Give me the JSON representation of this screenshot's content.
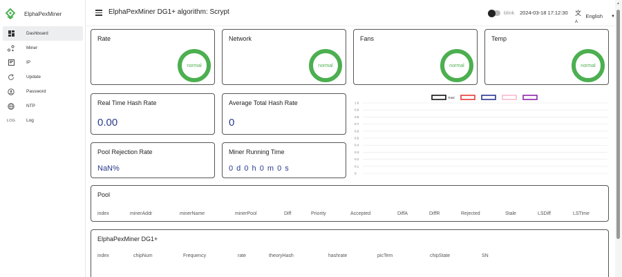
{
  "brand": {
    "name": "ElphaPexMiner"
  },
  "sidebar": {
    "items": [
      {
        "label": "Dashboard",
        "icon": "dashboard-icon",
        "active": true
      },
      {
        "label": "Miner",
        "icon": "miner-icon"
      },
      {
        "label": "IP",
        "icon": "ip-icon"
      },
      {
        "label": "Update",
        "icon": "update-icon"
      },
      {
        "label": "Password",
        "icon": "password-icon"
      },
      {
        "label": "NTP",
        "icon": "ntp-icon"
      },
      {
        "label": "Log",
        "icon": "log-icon",
        "icon_text": "LOG"
      }
    ]
  },
  "header": {
    "title": "ElphaPexMiner DG1+ algorithm: Scrypt",
    "blink_label": "blink",
    "datetime": "2024-03-18 17:12:30",
    "language": "English"
  },
  "status_cards": [
    {
      "title": "Rate",
      "status": "normal"
    },
    {
      "title": "Network",
      "status": "normal"
    },
    {
      "title": "Fans",
      "status": "normal"
    },
    {
      "title": "Temp",
      "status": "normal"
    }
  ],
  "stats": {
    "realtime_hash_rate": {
      "title": "Real Time Hash Rate",
      "value": "0.00"
    },
    "avg_hash_rate": {
      "title": "Average Total Hash Rate",
      "value": "0"
    },
    "pool_rejection": {
      "title": "Pool Rejection Rate",
      "value": "NaN%"
    },
    "running_time": {
      "title": "Miner Running Time",
      "value": "0 d 0 h 0 m 0 s"
    }
  },
  "chart_data": {
    "type": "line",
    "yticks": [
      "1.0",
      "0.9",
      "0.8",
      "0.7",
      "0.6",
      "0.5",
      "0.4",
      "0.3",
      "0.2",
      "0.1",
      "0"
    ],
    "ylim": [
      0,
      1
    ],
    "grid": true,
    "legend_position": "top-center",
    "series": [
      {
        "name": "Total",
        "color": "#111111",
        "values": []
      },
      {
        "color": "#e53935",
        "values": []
      },
      {
        "color": "#283593",
        "values": []
      },
      {
        "color": "#f8bbd0",
        "values": []
      },
      {
        "color": "#8e24aa",
        "values": []
      }
    ]
  },
  "pool": {
    "title": "Pool",
    "columns": [
      "index",
      "minerAddr",
      "minerName",
      "minerPool",
      "Diff",
      "Priority",
      "Accepted",
      "DiffA",
      "DiffR",
      "Rejected",
      "Stale",
      "LSDiff",
      "LSTime"
    ]
  },
  "miner": {
    "title": "ElphaPexMiner DG1+",
    "columns": [
      "index",
      "chipNum",
      "Frequency",
      "rate",
      "theoryHash",
      "hashrate",
      "picTem",
      "chipState",
      "SN"
    ]
  },
  "colors": {
    "accent": "#4caf50",
    "value": "#2a3a8c",
    "border": "#555555"
  }
}
